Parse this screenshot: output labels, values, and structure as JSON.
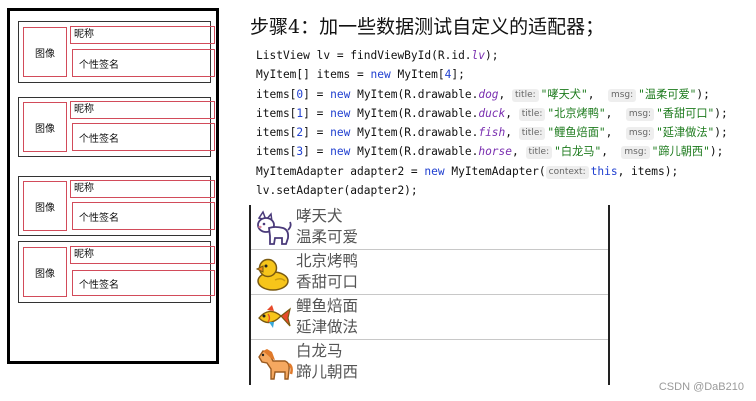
{
  "mock": {
    "items": [
      {
        "image": "图像",
        "nickname": "昵称",
        "signature": "个性签名"
      },
      {
        "image": "图像",
        "nickname": "昵称",
        "signature": "个性签名"
      },
      {
        "image": "图像",
        "nickname": "昵称",
        "signature": "个性签名"
      },
      {
        "image": "图像",
        "nickname": "昵称",
        "signature": "个性签名"
      }
    ]
  },
  "step_title": "步骤4：加一些数据测试自定义的适配器；",
  "code": {
    "l1": {
      "a": "ListView lv = findViewById(R.id.",
      "b": "lv",
      "c": ");"
    },
    "l2": {
      "a": "MyItem[] items = ",
      "kw": "new",
      "b": " MyItem[",
      "n": "4",
      "c": "];"
    },
    "items": [
      {
        "pre": "items[",
        "idx": "0",
        "mid": "] = ",
        "kw": "new",
        "cls": " MyItem(R.drawable.",
        "res": "dog",
        "sep": ", ",
        "h1": "title:",
        "s1": "\"哮天犬\"",
        "sep2": ",  ",
        "h2": "msg:",
        "s2": "\"温柔可爱\"",
        "end": ");"
      },
      {
        "pre": "items[",
        "idx": "1",
        "mid": "] = ",
        "kw": "new",
        "cls": " MyItem(R.drawable.",
        "res": "duck",
        "sep": ", ",
        "h1": "title:",
        "s1": "\"北京烤鸭\"",
        "sep2": ",  ",
        "h2": "msg:",
        "s2": "\"香甜可口\"",
        "end": ");"
      },
      {
        "pre": "items[",
        "idx": "2",
        "mid": "] = ",
        "kw": "new",
        "cls": " MyItem(R.drawable.",
        "res": "fish",
        "sep": ", ",
        "h1": "title:",
        "s1": "\"鲤鱼焙面\"",
        "sep2": ",  ",
        "h2": "msg:",
        "s2": "\"延津做法\"",
        "end": ");"
      },
      {
        "pre": "items[",
        "idx": "3",
        "mid": "] = ",
        "kw": "new",
        "cls": " MyItem(R.drawable.",
        "res": "horse",
        "sep": ", ",
        "h1": "title:",
        "s1": "\"白龙马\"",
        "sep2": ",  ",
        "h2": "msg:",
        "s2": "\"蹄儿朝西\"",
        "end": ");"
      }
    ],
    "l7": {
      "a": "MyItemAdapter adapter2 = ",
      "kw": "new",
      "b": " MyItemAdapter(",
      "h": "context:",
      "kw2": "this",
      "c": ", items);"
    },
    "l8": "lv.setAdapter(adapter2);"
  },
  "preview": [
    {
      "icon": "dog-icon",
      "title": "哮天犬",
      "msg": "温柔可爱"
    },
    {
      "icon": "duck-icon",
      "title": "北京烤鸭",
      "msg": "香甜可口"
    },
    {
      "icon": "fish-icon",
      "title": "鲤鱼焙面",
      "msg": "延津做法"
    },
    {
      "icon": "horse-icon",
      "title": "白龙马",
      "msg": "蹄儿朝西"
    }
  ],
  "watermark": "CSDN @DaB210"
}
